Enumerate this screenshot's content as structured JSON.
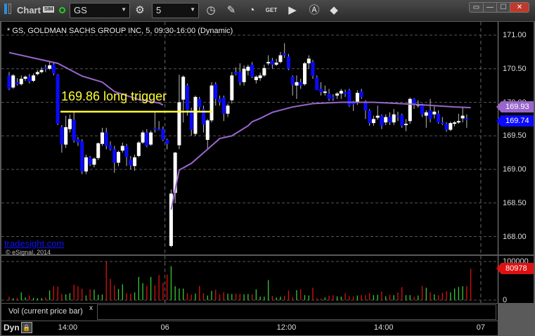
{
  "toolbar": {
    "title": "Chart",
    "sim_badge": "SIM",
    "symbol": "GS",
    "interval": "5",
    "icons": [
      "panel-icon",
      "settings-gear-icon",
      "clock-icon",
      "pencil-icon",
      "speedometer-icon",
      "get-icon",
      "play-icon",
      "a-circle-icon",
      "ticket-icon"
    ],
    "get_label": "GET",
    "window_buttons": [
      "restore-menu",
      "minimize",
      "maximize",
      "close"
    ]
  },
  "colors": {
    "up_candle": "#ffffff",
    "down_candle": "#0a0aff",
    "vwap": "#9966cc",
    "trigger": "#ffff33",
    "vol_up": "#33cc33",
    "vol_down": "#dd1111",
    "grid": "#555555"
  },
  "header": {
    "info": "* GS, GOLDMAN SACHS GROUP INC, 5, 09:30-16:00 (Dynamic)"
  },
  "annotation": {
    "text": "169.86 long trigger",
    "price": 169.86
  },
  "watermark": "tradesight.com",
  "copyright": "© eSignal, 2014",
  "study": {
    "label": "Vol (current price bar)",
    "close": "x"
  },
  "footer": {
    "dyn": "Dyn"
  },
  "chart_data": {
    "type": "candlestick",
    "price_ticks": [
      "171.00",
      "170.50",
      "170.00",
      "169.50",
      "169.00",
      "168.50",
      "168.00"
    ],
    "ylim": [
      167.78,
      171.2
    ],
    "grid": true,
    "time_ticks": [
      {
        "label": "14:00",
        "bar": 15
      },
      {
        "label": "06",
        "bar": 39
      },
      {
        "label": "12:00",
        "bar": 69
      },
      {
        "label": "14:00",
        "bar": 93
      },
      {
        "label": "07",
        "bar": 117
      }
    ],
    "session_break_bars": [
      39,
      117
    ],
    "last_price": "169.74",
    "vwap_last": "169.93",
    "candles": [
      [
        170.4,
        170.45,
        170.18,
        170.2
      ],
      [
        170.22,
        170.42,
        170.2,
        170.4
      ],
      [
        170.3,
        170.36,
        170.25,
        170.27
      ],
      [
        170.27,
        170.4,
        170.25,
        170.35
      ],
      [
        170.35,
        170.4,
        170.32,
        170.38
      ],
      [
        170.38,
        170.42,
        170.28,
        170.31
      ],
      [
        170.32,
        170.43,
        170.3,
        170.4
      ],
      [
        170.42,
        170.48,
        170.4,
        170.45
      ],
      [
        170.45,
        170.52,
        170.43,
        170.48
      ],
      [
        170.52,
        170.56,
        170.45,
        170.5
      ],
      [
        170.5,
        170.62,
        170.48,
        170.55
      ],
      [
        170.56,
        170.6,
        170.4,
        170.43
      ],
      [
        170.41,
        170.42,
        169.66,
        169.68
      ],
      [
        169.63,
        169.66,
        169.25,
        169.37
      ],
      [
        169.37,
        169.8,
        169.32,
        169.63
      ],
      [
        169.6,
        169.82,
        169.55,
        169.75
      ],
      [
        169.74,
        169.86,
        169.4,
        169.43
      ],
      [
        169.45,
        169.48,
        169.35,
        169.4
      ],
      [
        169.42,
        169.45,
        168.93,
        168.97
      ],
      [
        168.97,
        169.22,
        168.93,
        169.18
      ],
      [
        169.18,
        169.2,
        169.05,
        169.07
      ],
      [
        169.07,
        169.18,
        169.03,
        169.16
      ],
      [
        169.17,
        169.4,
        169.14,
        169.39
      ],
      [
        169.38,
        169.62,
        169.35,
        169.55
      ],
      [
        169.55,
        169.62,
        169.3,
        169.35
      ],
      [
        169.36,
        169.42,
        169.28,
        169.3
      ],
      [
        169.3,
        169.35,
        168.95,
        169.1
      ],
      [
        169.1,
        169.28,
        169.05,
        169.26
      ],
      [
        169.28,
        169.4,
        169.25,
        169.35
      ],
      [
        169.35,
        169.38,
        169.05,
        169.18
      ],
      [
        169.15,
        169.2,
        169.0,
        169.06
      ],
      [
        169.05,
        169.22,
        168.98,
        169.18
      ],
      [
        169.2,
        169.42,
        169.18,
        169.4
      ],
      [
        169.4,
        169.58,
        169.38,
        169.55
      ],
      [
        169.55,
        169.6,
        169.33,
        169.35
      ],
      [
        169.37,
        169.58,
        169.35,
        169.55
      ],
      [
        169.62,
        169.85,
        169.55,
        169.61
      ],
      [
        169.6,
        169.72,
        169.58,
        169.59
      ],
      [
        169.6,
        169.64,
        169.42,
        169.44
      ],
      [
        169.44,
        169.46,
        169.3,
        169.38
      ],
      [
        167.86,
        168.7,
        167.84,
        168.64
      ],
      [
        168.65,
        169.26,
        168.5,
        169.25
      ],
      [
        169.36,
        170.41,
        169.3,
        170.0
      ],
      [
        170.04,
        170.4,
        169.7,
        170.38
      ],
      [
        170.25,
        170.28,
        169.8,
        169.88
      ],
      [
        169.88,
        169.92,
        169.5,
        169.59
      ],
      [
        169.53,
        170.1,
        169.5,
        170.08
      ],
      [
        170.05,
        170.08,
        169.85,
        169.93
      ],
      [
        169.9,
        169.95,
        169.55,
        169.67
      ],
      [
        169.44,
        169.75,
        169.3,
        169.73
      ],
      [
        169.73,
        170.3,
        169.7,
        170.25
      ],
      [
        170.27,
        170.3,
        169.95,
        170.05
      ],
      [
        170.05,
        170.1,
        169.95,
        170.0
      ],
      [
        170.07,
        170.1,
        169.72,
        169.83
      ],
      [
        169.83,
        169.98,
        169.78,
        169.95
      ],
      [
        170.03,
        170.45,
        169.98,
        170.4
      ],
      [
        170.45,
        170.52,
        170.4,
        170.42
      ],
      [
        170.45,
        170.58,
        170.25,
        170.3
      ],
      [
        170.3,
        170.55,
        170.25,
        170.5
      ],
      [
        170.47,
        170.56,
        170.4,
        170.53
      ],
      [
        170.56,
        170.6,
        170.36,
        170.38
      ],
      [
        170.33,
        170.4,
        170.28,
        170.38
      ],
      [
        170.36,
        170.44,
        170.32,
        170.4
      ],
      [
        170.4,
        170.56,
        170.38,
        170.51
      ],
      [
        170.58,
        170.7,
        170.55,
        170.6
      ],
      [
        170.62,
        170.66,
        170.5,
        170.56
      ],
      [
        170.56,
        170.65,
        170.54,
        170.59
      ],
      [
        170.6,
        170.75,
        170.58,
        170.7
      ],
      [
        170.73,
        170.88,
        170.66,
        170.7
      ],
      [
        170.68,
        170.72,
        170.48,
        170.5
      ],
      [
        170.38,
        170.4,
        170.1,
        170.26
      ],
      [
        170.25,
        170.4,
        170.05,
        170.3
      ],
      [
        170.3,
        170.35,
        170.2,
        170.25
      ],
      [
        170.27,
        170.6,
        170.25,
        170.58
      ],
      [
        170.58,
        170.7,
        170.5,
        170.65
      ],
      [
        170.6,
        170.63,
        170.35,
        170.39
      ],
      [
        170.37,
        170.4,
        170.2,
        170.18
      ],
      [
        170.2,
        170.3,
        170.1,
        170.15
      ],
      [
        170.14,
        170.25,
        170.1,
        170.16
      ],
      [
        170.13,
        170.2,
        170.02,
        170.05
      ],
      [
        170.08,
        170.12,
        170.02,
        170.07
      ],
      [
        170.1,
        170.15,
        170.05,
        170.13
      ],
      [
        170.13,
        170.2,
        170.05,
        170.17
      ],
      [
        170.15,
        170.19,
        170.08,
        170.12
      ],
      [
        170.18,
        170.2,
        169.93,
        169.95
      ],
      [
        169.99,
        170.02,
        169.87,
        169.98
      ],
      [
        169.99,
        170.18,
        169.96,
        170.14
      ],
      [
        170.16,
        170.2,
        170.05,
        170.08
      ],
      [
        170.01,
        170.03,
        169.75,
        169.88
      ],
      [
        169.88,
        169.9,
        169.65,
        169.69
      ],
      [
        169.69,
        169.8,
        169.65,
        169.75
      ],
      [
        169.77,
        169.95,
        169.74,
        169.8
      ],
      [
        169.8,
        169.82,
        169.6,
        169.65
      ],
      [
        169.7,
        169.82,
        169.66,
        169.78
      ],
      [
        169.78,
        169.85,
        169.66,
        169.7
      ],
      [
        169.7,
        169.9,
        169.66,
        169.82
      ],
      [
        169.8,
        169.86,
        169.72,
        169.79
      ],
      [
        169.81,
        169.83,
        169.62,
        169.65
      ],
      [
        169.67,
        169.75,
        169.57,
        169.68
      ],
      [
        169.72,
        170.07,
        169.68,
        170.05
      ],
      [
        170.05,
        170.06,
        169.9,
        169.96
      ],
      [
        169.96,
        170.03,
        169.92,
        169.97
      ],
      [
        169.96,
        169.98,
        169.78,
        169.82
      ],
      [
        169.8,
        169.88,
        169.62,
        169.85
      ],
      [
        169.88,
        170.05,
        169.7,
        169.75
      ],
      [
        169.82,
        169.94,
        169.76,
        169.86
      ],
      [
        169.83,
        169.88,
        169.68,
        169.7
      ],
      [
        169.7,
        169.78,
        169.66,
        169.69
      ],
      [
        169.68,
        169.7,
        169.56,
        169.59
      ],
      [
        169.59,
        169.71,
        169.57,
        169.69
      ],
      [
        169.69,
        169.72,
        169.64,
        169.7
      ],
      [
        169.71,
        169.83,
        169.68,
        169.72
      ],
      [
        169.76,
        169.93,
        169.7,
        169.8
      ],
      [
        169.76,
        169.82,
        169.62,
        169.74
      ]
    ],
    "vwap": [
      [
        0,
        170.74
      ],
      [
        12,
        170.58
      ],
      [
        18,
        170.39
      ],
      [
        23,
        170.3
      ],
      [
        26,
        170.16
      ],
      [
        32,
        170.04
      ],
      [
        37,
        169.99
      ],
      [
        38,
        169.96
      ],
      [
        40,
        168.4
      ],
      [
        42,
        168.99
      ],
      [
        45,
        169.09
      ],
      [
        49,
        169.3
      ],
      [
        52,
        169.46
      ],
      [
        55,
        169.5
      ],
      [
        59,
        169.65
      ],
      [
        60,
        169.71
      ],
      [
        62,
        169.76
      ],
      [
        65,
        169.85
      ],
      [
        70,
        169.93
      ],
      [
        75,
        169.98
      ],
      [
        82,
        170.0
      ],
      [
        90,
        170.0
      ],
      [
        100,
        169.97
      ],
      [
        110,
        169.93
      ],
      [
        114,
        169.92
      ]
    ],
    "volume": {
      "ticks": [
        "100000",
        "0"
      ],
      "ylim": [
        0,
        100000
      ],
      "last": "80978",
      "values": [
        9000,
        5000,
        6000,
        20000,
        7000,
        12000,
        6000,
        5000,
        5000,
        7000,
        25000,
        36000,
        35000,
        16000,
        15000,
        18000,
        40000,
        36000,
        30000,
        12000,
        28000,
        27000,
        14000,
        15000,
        100000,
        55000,
        38000,
        29000,
        41000,
        18000,
        17000,
        20000,
        60000,
        44000,
        37000,
        60000,
        38000,
        65000,
        45000,
        66000,
        88000,
        36000,
        30000,
        30000,
        18000,
        14000,
        17000,
        37000,
        18000,
        12000,
        24000,
        27000,
        15000,
        21000,
        17000,
        16000,
        17000,
        16000,
        15000,
        16000,
        15000,
        28000,
        9000,
        9000,
        52000,
        11000,
        7000,
        9000,
        11000,
        25000,
        8000,
        26000,
        28000,
        13000,
        12000,
        32000,
        5000,
        4000,
        7000,
        11000,
        13000,
        10000,
        9000,
        18000,
        10000,
        10000,
        12000,
        13000,
        13000,
        18000,
        13000,
        14000,
        22000,
        10000,
        14000,
        13000,
        20000,
        34000,
        13000,
        13000,
        9000,
        12000,
        37000,
        32000,
        20000,
        15000,
        13000,
        19000,
        23000,
        20000,
        30000,
        34000,
        36000,
        36000,
        80978
      ]
    }
  }
}
